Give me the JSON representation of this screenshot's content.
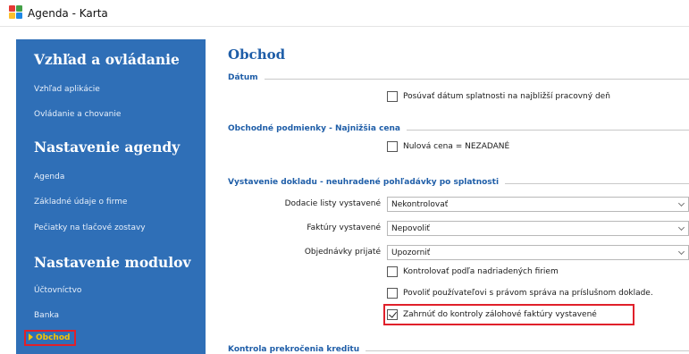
{
  "window": {
    "title": "Agenda - Karta"
  },
  "sidebar": {
    "groups": [
      {
        "heading": "Vzhľad a ovládanie",
        "items": [
          "Vzhľad aplikácie",
          "Ovládanie a chovanie"
        ]
      },
      {
        "heading": "Nastavenie agendy",
        "items": [
          "Agenda",
          "Základné údaje o firme",
          "Pečiatky na tlačové zostavy"
        ]
      },
      {
        "heading": "Nastavenie modulov",
        "items": [
          "Účtovníctvo",
          "Banka",
          "Obchod"
        ]
      }
    ],
    "active_item": "Obchod"
  },
  "main": {
    "title": "Obchod",
    "sections": {
      "datum": {
        "label": "Dátum",
        "checkbox": {
          "label": "Posúvať dátum splatnosti na najbližší pracovný deň",
          "checked": false
        }
      },
      "podmienky": {
        "label": "Obchodné podmienky - Najnižšia cena",
        "checkbox": {
          "label": "Nulová cena = NEZADANÉ",
          "checked": false
        }
      },
      "vystavenie": {
        "label": "Vystavenie dokladu - neuhradené pohľadávky po splatnosti",
        "fields": [
          {
            "label": "Dodacie listy vystavené",
            "value": "Nekontrolovať"
          },
          {
            "label": "Faktúry vystavené",
            "value": "Nepovoliť"
          },
          {
            "label": "Objednávky prijaté",
            "value": "Upozorniť"
          }
        ],
        "checkboxes": [
          {
            "label": "Kontrolovať podľa nadriadených firiem",
            "checked": false
          },
          {
            "label": "Povoliť používateľovi s právom správa na príslušnom doklade.",
            "checked": false
          },
          {
            "label": "Zahrnúť do kontroly zálohové faktúry vystavené",
            "checked": true
          }
        ]
      },
      "kredit": {
        "label": "Kontrola prekročenia kreditu"
      }
    }
  }
}
